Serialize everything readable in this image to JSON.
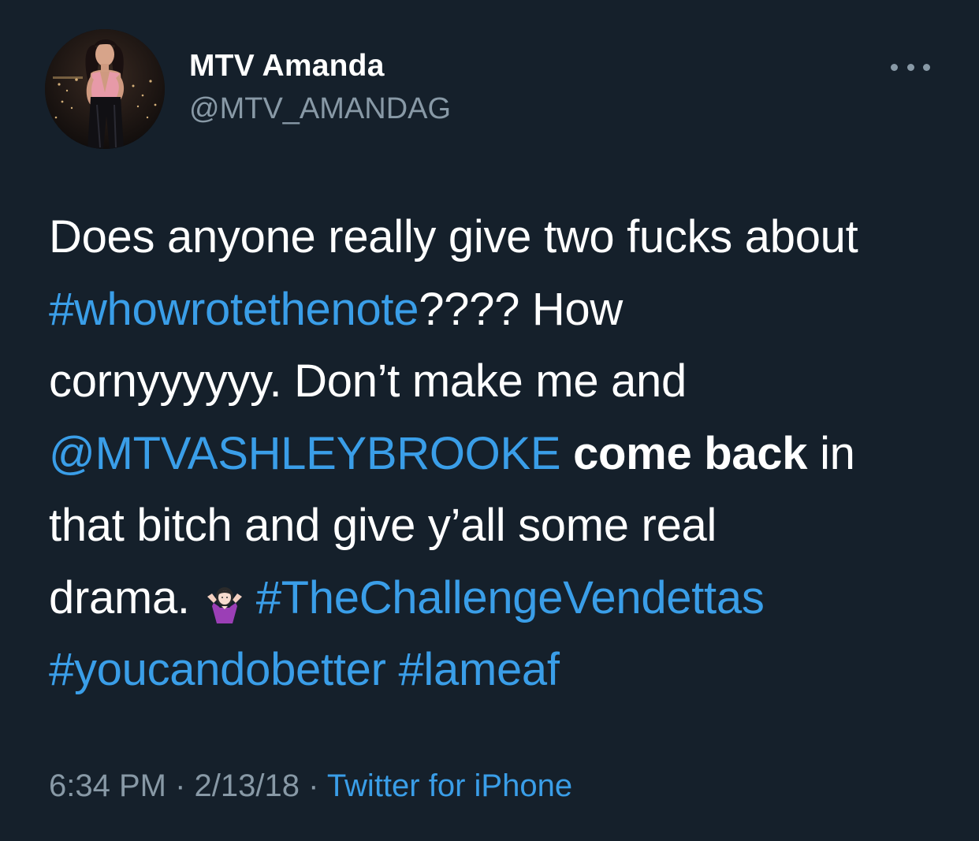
{
  "user": {
    "display_name": "MTV Amanda",
    "handle": "@MTV_AMANDAG"
  },
  "icons": {
    "more": "more-horizontal-icon",
    "emoji": "person-shrugging-emoji"
  },
  "tweet": {
    "line1": "Does anyone really give two fucks about",
    "hashtag1": "#whowrotethenote",
    "text2": "???? How",
    "line3": "cornyyyyyy. Don’t make me and",
    "mention": "@MTVASHLEYBROOKE",
    "bold_text": "come back",
    "text4": "in",
    "line5": "that bitch and give y’all some real",
    "text6": "drama.",
    "hashtag2": "#TheChallengeVendettas",
    "hashtag3": "#youcandobetter",
    "hashtag4": "#lameaf"
  },
  "meta": {
    "time": "6:34 PM",
    "sep1": " · ",
    "date": "2/13/18",
    "sep2": " · ",
    "source": "Twitter for iPhone"
  },
  "colors": {
    "background": "#15202b",
    "link": "#3a9ee8",
    "secondary_text": "#8899a6",
    "primary_text": "#ffffff"
  }
}
